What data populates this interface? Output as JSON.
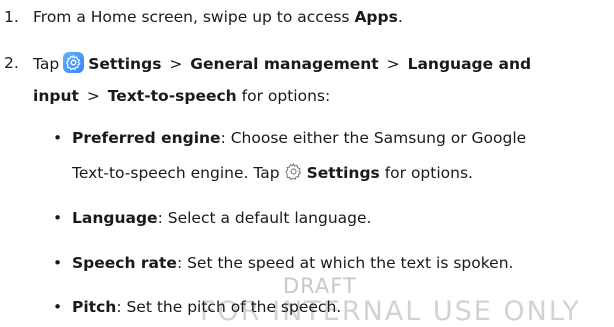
{
  "watermark": {
    "line1": "DRAFT",
    "line2": "FOR INTERNAL USE ONLY"
  },
  "steps": [
    {
      "number": "1.",
      "pre": "From a Home screen, swipe up to access ",
      "apps": "Apps",
      "post": "."
    },
    {
      "number": "2.",
      "tap": "Tap",
      "settings": "Settings",
      "sep": ">",
      "general": "General management",
      "language_and": "Language and",
      "input": "input",
      "tts": "Text-to-speech",
      "for_options": "for options:"
    }
  ],
  "bullets": [
    {
      "term": "Preferred engine",
      "line1": ": Choose either the Samsung or Google",
      "line2_pre": "Text-to-speech engine. Tap",
      "line2_settings": "Settings",
      "line2_post": " for options."
    },
    {
      "term": "Language",
      "text": ": Select a default language."
    },
    {
      "term": "Speech rate",
      "text": ": Set the speed at which the text is spoken."
    },
    {
      "term": "Pitch",
      "text": ": Set the pitch of the speech."
    }
  ],
  "bullet_glyph": "•",
  "icons": {
    "settings_badge": "settings-gear-icon",
    "settings_outline": "settings-gear-outline-icon"
  },
  "colors": {
    "badge": "#3b82f6",
    "text": "#1a1a1a",
    "watermark": "#c8c8c8"
  }
}
